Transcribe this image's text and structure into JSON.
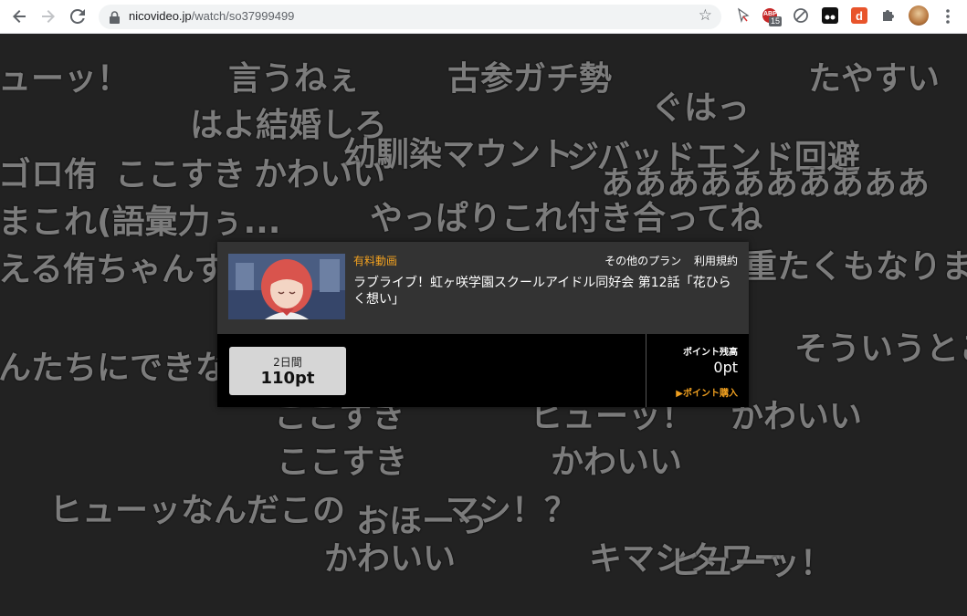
{
  "browser": {
    "url_host": "nicovideo.jp",
    "url_path": "/watch/so37999499",
    "extension_badge": "15",
    "extension_badge_label": "ABP"
  },
  "comments": [
    "ューッ！",
    "言うねぇ",
    "古参ガチ勢",
    "たやすい",
    "はよ結婚しろ",
    "ぐはっ",
    "幼馴染マウント",
    "ジバッドエンド回避",
    "ゴロ侑",
    "ここすき",
    "かわいい",
    "ああああああああああ",
    "まこれ(語彙力ぅ...",
    "やっぱりこれ付き合ってね",
    "える侑ちゃんす",
    "重たくもなりま",
    "んたちにできな",
    "そういうとこ",
    "ここすき",
    "ヒューッ！",
    "かわいい",
    "ここすき",
    "かわいい",
    "ヒューッなんだこの",
    "おほーっ",
    "マシ！？",
    "かわいい",
    "キマシタワー",
    "ヒューッ！"
  ],
  "dialog": {
    "paid_label": "有料動画",
    "other_plans": "その他のプラン",
    "terms": "利用規約",
    "title": "ラブライブ！虹ヶ咲学園スクールアイドル同好会 第12話「花ひらく想い」",
    "price_period": "2日間",
    "price": "110pt",
    "points_label": "ポイント残高",
    "points_value": "0pt",
    "buy_points": "▶ポイント購入"
  },
  "colors": {
    "accent": "#f0a020",
    "background": "#222222",
    "comment": "#7c7c7c"
  }
}
